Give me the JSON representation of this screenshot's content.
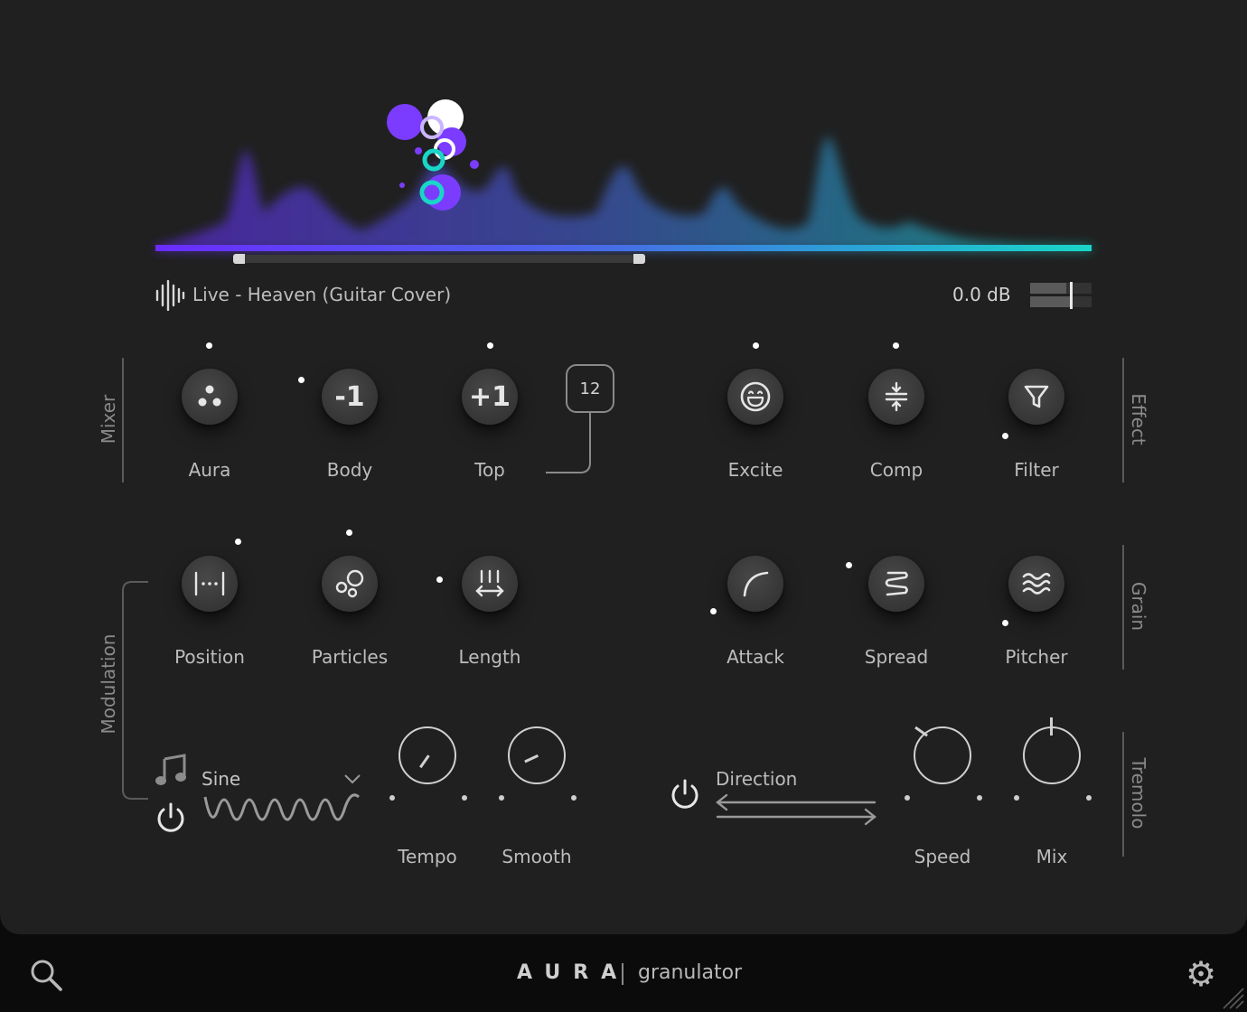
{
  "track": {
    "name": "Live - Heaven (Guitar Cover)",
    "level": "0.0 dB",
    "icon": "waveform-icon"
  },
  "sections": {
    "mixer": "Mixer",
    "effect": "Effect",
    "modulation": "Modulation",
    "grain": "Grain",
    "tremolo": "Tremolo"
  },
  "mixer": {
    "aura": {
      "label": "Aura",
      "icon": "three-dots-icon"
    },
    "body": {
      "label": "Body",
      "value": "-1"
    },
    "top": {
      "label": "Top",
      "value": "+1"
    },
    "semitones": "12"
  },
  "effect": {
    "excite": {
      "label": "Excite",
      "icon": "smiley-icon"
    },
    "comp": {
      "label": "Comp",
      "icon": "compress-icon"
    },
    "filter": {
      "label": "Filter",
      "icon": "funnel-icon"
    }
  },
  "modulation": {
    "position": {
      "label": "Position",
      "icon": "bracket-range-icon"
    },
    "particles": {
      "label": "Particles",
      "icon": "bubbles-icon"
    },
    "length": {
      "label": "Length",
      "icon": "length-arrows-icon"
    },
    "waveform": "Sine",
    "tempo": {
      "label": "Tempo"
    },
    "smooth": {
      "label": "Smooth"
    }
  },
  "grain": {
    "attack": {
      "label": "Attack",
      "icon": "curve-icon"
    },
    "spread": {
      "label": "Spread",
      "icon": "spring-icon"
    },
    "pitcher": {
      "label": "Pitcher",
      "icon": "waves-icon"
    }
  },
  "tremolo": {
    "direction": "Direction",
    "speed": {
      "label": "Speed"
    },
    "mix": {
      "label": "Mix"
    }
  },
  "footer": {
    "brand": "AURA",
    "product": "granulator"
  },
  "colors": {
    "accent_purple": "#7b3cff",
    "accent_teal": "#19d6c8",
    "panel": "#202020"
  }
}
